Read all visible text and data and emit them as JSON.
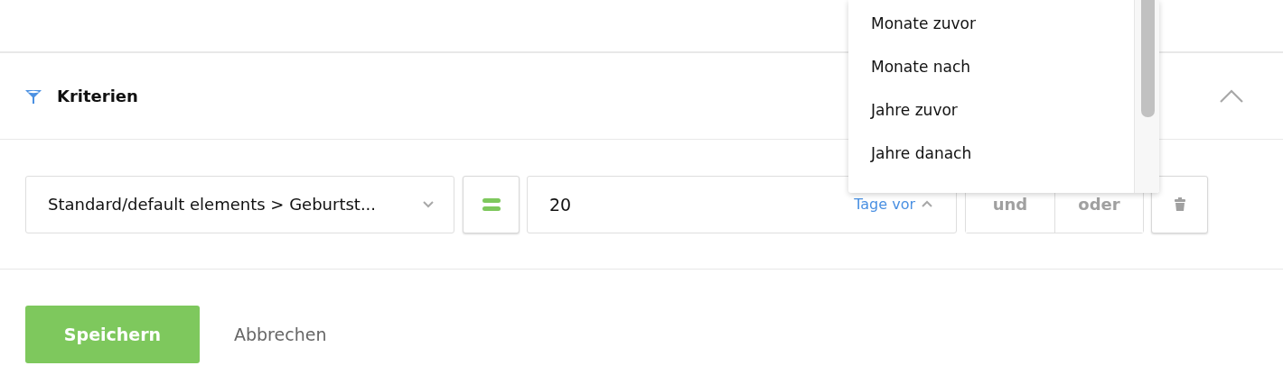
{
  "section": {
    "title": "Kriterien",
    "expanded": true
  },
  "criterion": {
    "field": "Standard/default elements > Geburtst...",
    "value": "20",
    "unit": "Tage vor",
    "unit_open": true,
    "logic": [
      {
        "label": "und",
        "selected": false
      },
      {
        "label": "oder",
        "selected": false
      }
    ]
  },
  "dropdown": {
    "options": [
      "Monate zuvor",
      "Monate nach",
      "Jahre zuvor",
      "Jahre danach"
    ]
  },
  "buttons": [
    {
      "label": "Speichern",
      "kind": "primary"
    },
    {
      "label": "Abbrechen",
      "kind": "link"
    }
  ]
}
